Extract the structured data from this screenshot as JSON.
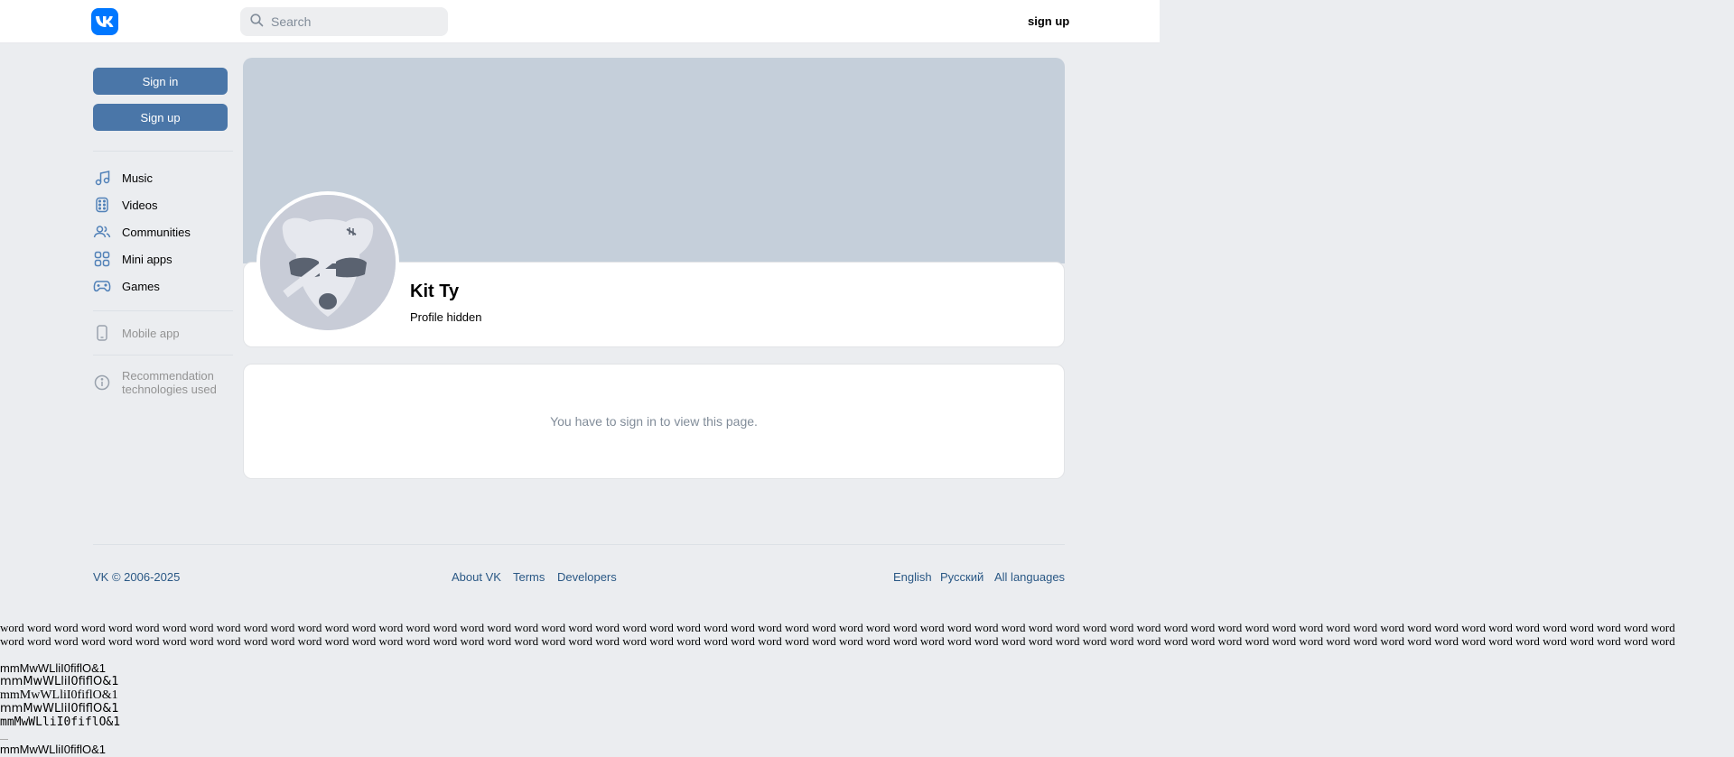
{
  "header": {
    "logo": "vk-logo",
    "search_placeholder": "Search",
    "signup_link": "sign up"
  },
  "sidebar": {
    "signin_button": "Sign in",
    "signup_button": "Sign up",
    "nav": [
      {
        "label": "Music",
        "icon": "music-note-icon"
      },
      {
        "label": "Videos",
        "icon": "video-icon"
      },
      {
        "label": "Communities",
        "icon": "users-icon"
      },
      {
        "label": "Mini apps",
        "icon": "grid-icon"
      },
      {
        "label": "Games",
        "icon": "gamepad-icon"
      }
    ],
    "mobile_app": {
      "label": "Mobile app",
      "icon": "phone-icon"
    },
    "recommendations": {
      "line1": "Recommendation",
      "line2": "technologies used",
      "icon": "info-icon"
    }
  },
  "profile": {
    "name": "Kit Ty",
    "status": "Profile hidden",
    "avatar": "deactivated-dog-avatar"
  },
  "notice": {
    "text": "You have to sign in to view this page."
  },
  "footer": {
    "copyright": "VK © 2006-2025",
    "links": [
      "About VK",
      "Terms",
      "Developers"
    ],
    "languages": [
      "English",
      "Русский",
      "All languages"
    ]
  },
  "test_text": {
    "word_line": "word word word word word word word word word word word word word word word word word word word word word word word word word word word word word word word word word word word word word word word word word word word word word word word word word word word word word word word word word word word word word word",
    "samples": [
      "mmMwWLliI0fiflO&1",
      "mmMwWLliI0fiflO&1",
      "mmMwWLliI0fiflO&1",
      "mmMwWLliI0fiflO&1",
      "mmMwWLliI0fiflO&1",
      "mmMwWLliI0fiflO&1"
    ]
  },
  "colors": {
    "accent": "#0077ff",
    "button": "#4a76a8",
    "cover": "#c5cfda",
    "background": "#ebedf0",
    "link": "#2a5885"
  }
}
